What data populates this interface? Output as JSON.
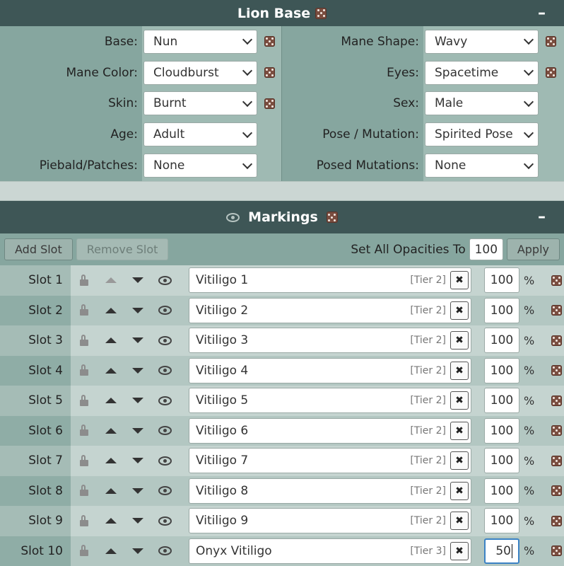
{
  "lion_base": {
    "title": "Lion Base",
    "collapse": "–",
    "left": [
      {
        "label": "Base:",
        "value": "Nun",
        "dice": true
      },
      {
        "label": "Mane Color:",
        "value": "Cloudburst",
        "dice": true
      },
      {
        "label": "Skin:",
        "value": "Burnt",
        "dice": true
      },
      {
        "label": "Age:",
        "value": "Adult",
        "dice": false
      },
      {
        "label": "Piebald/Patches:",
        "value": "None",
        "dice": false
      }
    ],
    "right": [
      {
        "label": "Mane Shape:",
        "value": "Wavy",
        "dice": true
      },
      {
        "label": "Eyes:",
        "value": "Spacetime",
        "dice": true
      },
      {
        "label": "Sex:",
        "value": "Male",
        "dice": false
      },
      {
        "label": "Pose / Mutation:",
        "value": "Spirited Pose",
        "dice": false
      },
      {
        "label": "Posed Mutations:",
        "value": "None",
        "dice": false
      }
    ]
  },
  "markings": {
    "title": "Markings",
    "collapse": "–",
    "add_slot": "Add Slot",
    "remove_slot": "Remove Slot",
    "opacity_label": "Set All Opacities To",
    "opacity_value": "100",
    "apply": "Apply",
    "percent": "%",
    "remove_x": "✖",
    "slots": [
      {
        "slot": "Slot 1",
        "name": "Vitiligo 1",
        "tier": "[Tier 2]",
        "opacity": "100"
      },
      {
        "slot": "Slot 2",
        "name": "Vitiligo 2",
        "tier": "[Tier 2]",
        "opacity": "100"
      },
      {
        "slot": "Slot 3",
        "name": "Vitiligo 3",
        "tier": "[Tier 2]",
        "opacity": "100"
      },
      {
        "slot": "Slot 4",
        "name": "Vitiligo 4",
        "tier": "[Tier 2]",
        "opacity": "100"
      },
      {
        "slot": "Slot 5",
        "name": "Vitiligo 5",
        "tier": "[Tier 2]",
        "opacity": "100"
      },
      {
        "slot": "Slot 6",
        "name": "Vitiligo 6",
        "tier": "[Tier 2]",
        "opacity": "100"
      },
      {
        "slot": "Slot 7",
        "name": "Vitiligo 7",
        "tier": "[Tier 2]",
        "opacity": "100"
      },
      {
        "slot": "Slot 8",
        "name": "Vitiligo 8",
        "tier": "[Tier 2]",
        "opacity": "100"
      },
      {
        "slot": "Slot 9",
        "name": "Vitiligo 9",
        "tier": "[Tier 2]",
        "opacity": "100"
      },
      {
        "slot": "Slot 10",
        "name": "Onyx Vitiligo",
        "tier": "[Tier 3]",
        "opacity": "50"
      }
    ]
  }
}
